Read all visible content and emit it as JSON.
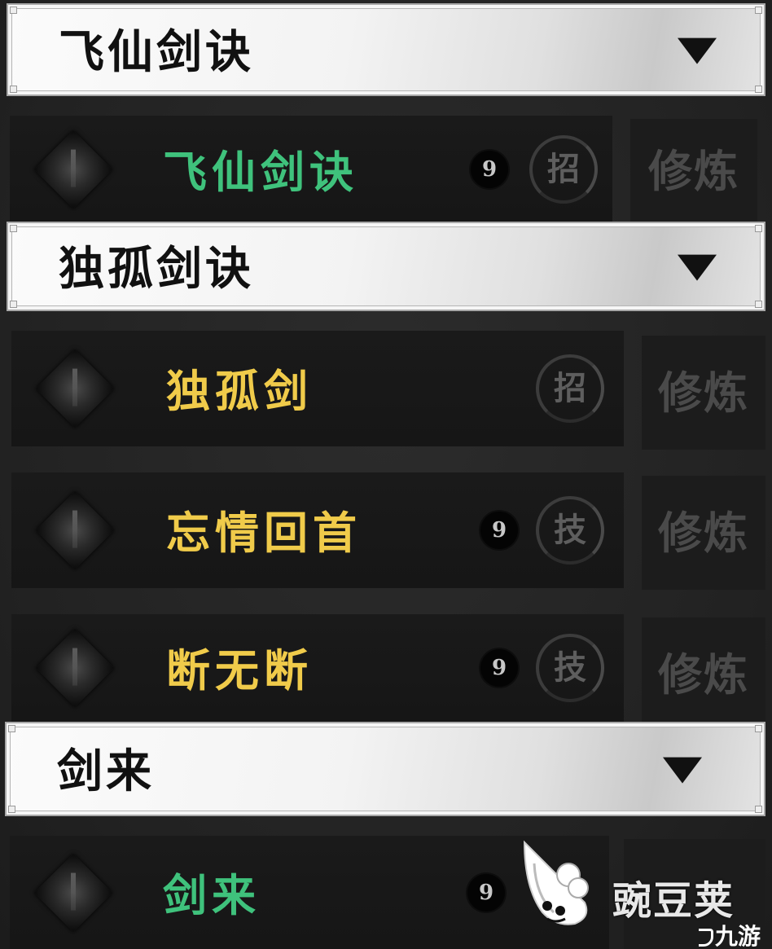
{
  "sections": [
    {
      "title": "飞仙剑诀",
      "skills": [
        {
          "name": "飞仙剑诀",
          "name_color": "green",
          "level": "9",
          "type": "招",
          "practice_label": "修炼"
        }
      ]
    },
    {
      "title": "独孤剑诀",
      "skills": [
        {
          "name": "独孤剑",
          "name_color": "gold",
          "level": "",
          "type": "招",
          "practice_label": "修炼"
        },
        {
          "name": "忘情回首",
          "name_color": "gold",
          "level": "9",
          "type": "技",
          "practice_label": "修炼"
        },
        {
          "name": "断无断",
          "name_color": "gold",
          "level": "9",
          "type": "技",
          "practice_label": "修炼"
        }
      ]
    },
    {
      "title": "剑来",
      "skills": [
        {
          "name": "剑来",
          "name_color": "green",
          "level": "9",
          "type": "",
          "practice_label": ""
        }
      ]
    }
  ],
  "watermarks": {
    "wandoujia": "豌豆荚",
    "jiuyou": "九游"
  },
  "colors": {
    "green": "#3fc27c",
    "gold": "#f0cb4a",
    "header_bg": "#f3f3f3",
    "row_bg": "#1a1a1a"
  },
  "icons": {
    "dropdown": "triangle-down-icon",
    "skill": "diamond-skill-icon"
  }
}
